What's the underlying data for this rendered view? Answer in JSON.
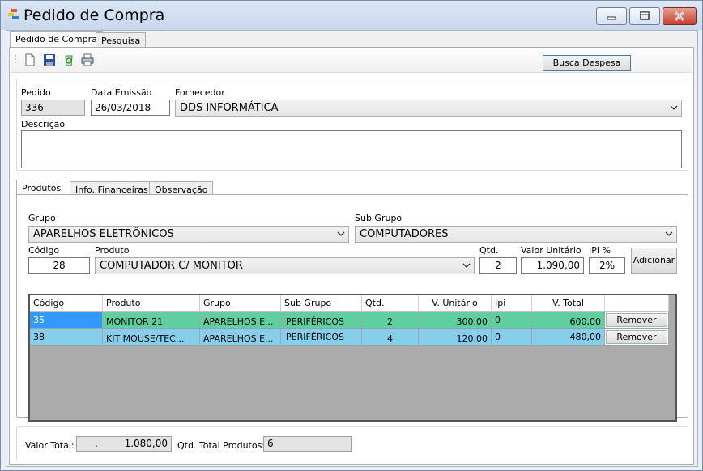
{
  "window": {
    "title": "Pedido de Compra"
  },
  "tabs": [
    {
      "label": "Pedido de Compra"
    },
    {
      "label": "Pesquisa"
    }
  ],
  "toolbar": {
    "busca_label": "Busca Despesa",
    "icons": [
      "new-document-icon",
      "save-icon",
      "recycle-icon",
      "print-icon"
    ]
  },
  "header": {
    "pedido_label": "Pedido",
    "pedido_value": "336",
    "data_label": "Data Emissão",
    "data_value": "26/03/2018",
    "fornecedor_label": "Fornecedor",
    "fornecedor_value": "DDS INFORMÁTICA",
    "descricao_label": "Descrição",
    "descricao_value": ""
  },
  "inner_tabs": [
    {
      "label": "Produtos"
    },
    {
      "label": "Info. Financeiras"
    },
    {
      "label": "Observação"
    }
  ],
  "produto_form": {
    "grupo_label": "Grupo",
    "grupo_value": "APARELHOS ELETRÔNICOS",
    "subgrupo_label": "Sub Grupo",
    "subgrupo_value": "COMPUTADORES",
    "codigo_label": "Código",
    "codigo_value": "28",
    "produto_label": "Produto",
    "produto_value": "COMPUTADOR C/ MONITOR",
    "qtd_label": "Qtd.",
    "qtd_value": "2",
    "valor_label": "Valor Unitário",
    "valor_value": "1.090,00",
    "ipi_label": "IPI %",
    "ipi_value": "2%",
    "adicionar_label": "Adicionar"
  },
  "grid": {
    "columns": [
      "Código",
      "Produto",
      "Grupo",
      "Sub Grupo",
      "Qtd.",
      "V. Unitário",
      "Ipi",
      "V. Total",
      ""
    ],
    "rows": [
      {
        "codigo": "35",
        "produto": "MONITOR 21'",
        "grupo": "APARELHOS E...",
        "subgrupo": "PERIFÉRICOS",
        "qtd": "2",
        "unitario": "300,00",
        "ipi": "0",
        "total": "600,00",
        "action": "Remover",
        "color": "#5fcf9f"
      },
      {
        "codigo": "38",
        "produto": "KIT MOUSE/TEC...",
        "grupo": "APARELHOS E...",
        "subgrupo": "PERIFÉRICOS",
        "qtd": "4",
        "unitario": "120,00",
        "ipi": "0",
        "total": "480,00",
        "action": "Remover",
        "color": "#87ceeb"
      }
    ]
  },
  "footer": {
    "valor_total_label": "Valor Total:",
    "valor_total_prefix": ".",
    "valor_total_value": "1.080,00",
    "qtd_total_label": "Qtd. Total Produtos:",
    "qtd_total_value": "6"
  }
}
